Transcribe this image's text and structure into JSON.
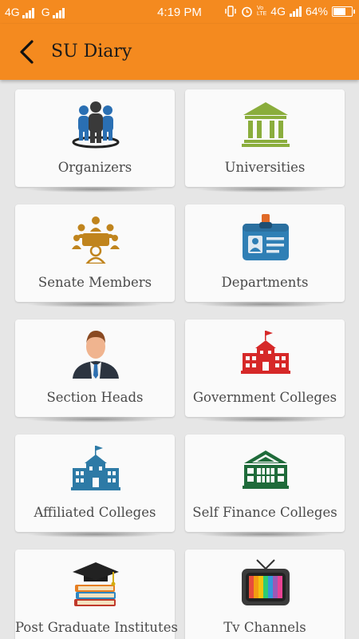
{
  "status_bar": {
    "network1": "4G",
    "network2": "G",
    "time": "4:19 PM",
    "volte": "Vo\nLTE",
    "network3": "4G",
    "battery": "64%"
  },
  "app_bar": {
    "title": "SU Diary"
  },
  "menu": [
    {
      "label": "Organizers",
      "icon": "organizers-icon"
    },
    {
      "label": "Universities",
      "icon": "university-building-icon"
    },
    {
      "label": "Senate Members",
      "icon": "meeting-icon"
    },
    {
      "label": "Departments",
      "icon": "id-badge-icon"
    },
    {
      "label": "Section Heads",
      "icon": "businessman-icon"
    },
    {
      "label": "Government Colleges",
      "icon": "red-college-icon"
    },
    {
      "label": "Affiliated Colleges",
      "icon": "blue-college-icon"
    },
    {
      "label": "Self Finance Colleges",
      "icon": "green-college-icon"
    },
    {
      "label": "Post Graduate Institutes",
      "icon": "books-cap-icon"
    },
    {
      "label": "Tv Channels",
      "icon": "television-icon"
    }
  ],
  "colors": {
    "primary": "#f48a1f",
    "background": "#e6e6e6",
    "card": "#fafafa"
  }
}
